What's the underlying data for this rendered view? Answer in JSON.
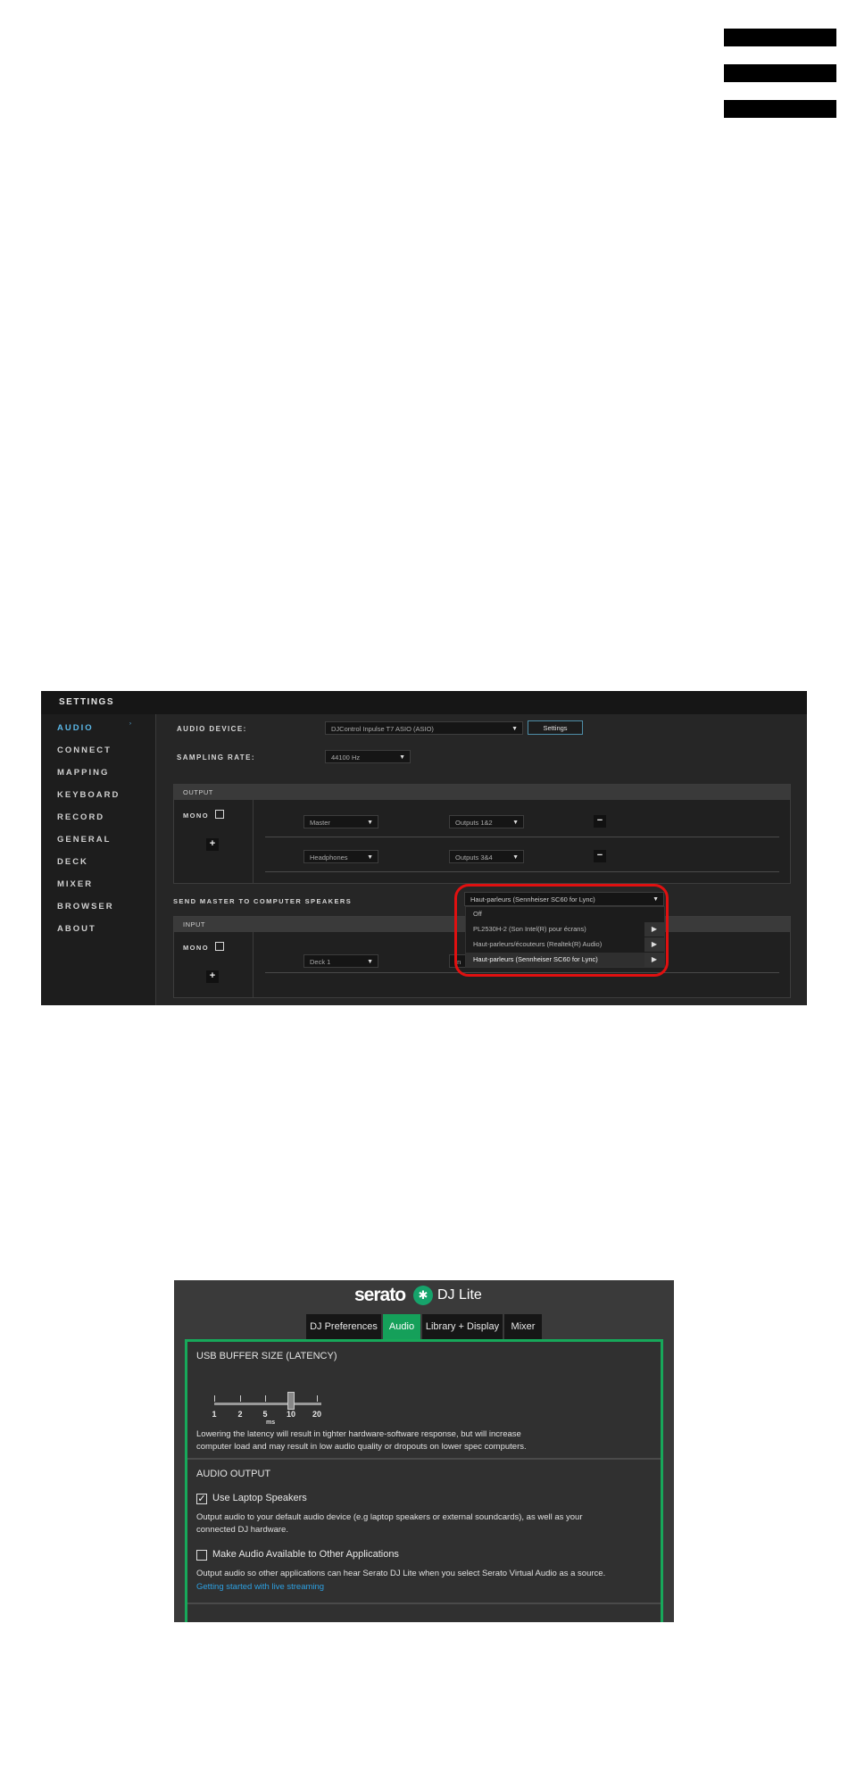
{
  "settings": {
    "title": "SETTINGS",
    "nav": [
      "AUDIO",
      "CONNECT",
      "MAPPING",
      "KEYBOARD",
      "RECORD",
      "GENERAL",
      "DECK",
      "MIXER",
      "BROWSER",
      "ABOUT"
    ],
    "nav_arrow": "›",
    "audio_device_label": "AUDIO DEVICE:",
    "audio_device_value": "DJControl Inpulse T7 ASIO (ASIO)",
    "settings_button": "Settings",
    "sampling_rate_label": "SAMPLING RATE:",
    "sampling_rate_value": "44100 Hz",
    "output": {
      "title": "OUTPUT",
      "mono_label": "MONO",
      "plus": "+",
      "minus": "−",
      "rows": [
        {
          "source": "Master",
          "outputs": "Outputs 1&2"
        },
        {
          "source": "Headphones",
          "outputs": "Outputs 3&4"
        }
      ]
    },
    "send_master_label": "SEND MASTER TO COMPUTER SPEAKERS",
    "speaker_select_value": "Haut-parleurs (Sennheiser SC60 for Lync)",
    "speaker_options": [
      {
        "label": "Off",
        "submenu": false
      },
      {
        "label": "PL2530H-2 (Son Intel(R) pour écrans)",
        "submenu": true
      },
      {
        "label": "Haut-parleurs/écouteurs (Realtek(R) Audio)",
        "submenu": true
      },
      {
        "label": "Haut-parleurs (Sennheiser SC60 for Lync)",
        "submenu": true,
        "selected": true
      }
    ],
    "submenu_arrow": "▶",
    "caret": "▼",
    "input": {
      "title": "INPUT",
      "mono_label": "MONO",
      "plus": "+",
      "row_source": "Deck 1",
      "row_partial": "In"
    }
  },
  "serato": {
    "brand": "serato",
    "product": "DJ Lite",
    "tabs": [
      "DJ Preferences",
      "Audio",
      "Library + Display",
      "Mixer"
    ],
    "active_tab": "Audio",
    "usb_buffer": {
      "title": "USB BUFFER SIZE (LATENCY)",
      "ticks": [
        "1",
        "2",
        "5",
        "10",
        "20"
      ],
      "unit": "ms",
      "value_ms": 10,
      "desc_line1": "Lowering the latency will result in tighter hardware-software response, but will increase",
      "desc_line2": "computer load and may result in low audio quality or dropouts on lower spec computers."
    },
    "audio_output": {
      "title": "AUDIO OUTPUT",
      "laptop_label": "Use Laptop Speakers",
      "laptop_checked": true,
      "laptop_desc1": "Output audio to your default audio device (e.g laptop speakers or external soundcards), as well as your",
      "laptop_desc2": "connected DJ hardware.",
      "share_label": "Make Audio Available to Other Applications",
      "share_checked": false,
      "share_desc": "Output audio so other applications can hear Serato DJ Lite when you select Serato Virtual Audio as a source.",
      "link": "Getting started with live streaming"
    },
    "check_mark": "✓"
  }
}
